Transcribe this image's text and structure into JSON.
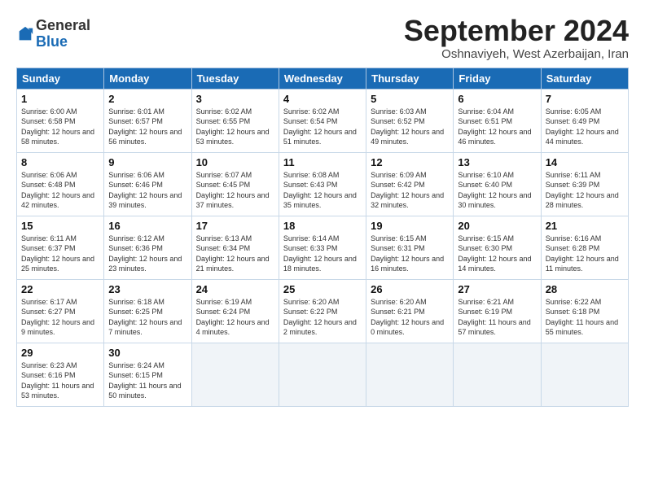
{
  "header": {
    "logo_general": "General",
    "logo_blue": "Blue",
    "month_title": "September 2024",
    "subtitle": "Oshnaviyeh, West Azerbaijan, Iran"
  },
  "weekdays": [
    "Sunday",
    "Monday",
    "Tuesday",
    "Wednesday",
    "Thursday",
    "Friday",
    "Saturday"
  ],
  "weeks": [
    [
      {
        "day": "1",
        "sunrise": "6:00 AM",
        "sunset": "6:58 PM",
        "daylight": "12 hours and 58 minutes."
      },
      {
        "day": "2",
        "sunrise": "6:01 AM",
        "sunset": "6:57 PM",
        "daylight": "12 hours and 56 minutes."
      },
      {
        "day": "3",
        "sunrise": "6:02 AM",
        "sunset": "6:55 PM",
        "daylight": "12 hours and 53 minutes."
      },
      {
        "day": "4",
        "sunrise": "6:02 AM",
        "sunset": "6:54 PM",
        "daylight": "12 hours and 51 minutes."
      },
      {
        "day": "5",
        "sunrise": "6:03 AM",
        "sunset": "6:52 PM",
        "daylight": "12 hours and 49 minutes."
      },
      {
        "day": "6",
        "sunrise": "6:04 AM",
        "sunset": "6:51 PM",
        "daylight": "12 hours and 46 minutes."
      },
      {
        "day": "7",
        "sunrise": "6:05 AM",
        "sunset": "6:49 PM",
        "daylight": "12 hours and 44 minutes."
      }
    ],
    [
      {
        "day": "8",
        "sunrise": "6:06 AM",
        "sunset": "6:48 PM",
        "daylight": "12 hours and 42 minutes."
      },
      {
        "day": "9",
        "sunrise": "6:06 AM",
        "sunset": "6:46 PM",
        "daylight": "12 hours and 39 minutes."
      },
      {
        "day": "10",
        "sunrise": "6:07 AM",
        "sunset": "6:45 PM",
        "daylight": "12 hours and 37 minutes."
      },
      {
        "day": "11",
        "sunrise": "6:08 AM",
        "sunset": "6:43 PM",
        "daylight": "12 hours and 35 minutes."
      },
      {
        "day": "12",
        "sunrise": "6:09 AM",
        "sunset": "6:42 PM",
        "daylight": "12 hours and 32 minutes."
      },
      {
        "day": "13",
        "sunrise": "6:10 AM",
        "sunset": "6:40 PM",
        "daylight": "12 hours and 30 minutes."
      },
      {
        "day": "14",
        "sunrise": "6:11 AM",
        "sunset": "6:39 PM",
        "daylight": "12 hours and 28 minutes."
      }
    ],
    [
      {
        "day": "15",
        "sunrise": "6:11 AM",
        "sunset": "6:37 PM",
        "daylight": "12 hours and 25 minutes."
      },
      {
        "day": "16",
        "sunrise": "6:12 AM",
        "sunset": "6:36 PM",
        "daylight": "12 hours and 23 minutes."
      },
      {
        "day": "17",
        "sunrise": "6:13 AM",
        "sunset": "6:34 PM",
        "daylight": "12 hours and 21 minutes."
      },
      {
        "day": "18",
        "sunrise": "6:14 AM",
        "sunset": "6:33 PM",
        "daylight": "12 hours and 18 minutes."
      },
      {
        "day": "19",
        "sunrise": "6:15 AM",
        "sunset": "6:31 PM",
        "daylight": "12 hours and 16 minutes."
      },
      {
        "day": "20",
        "sunrise": "6:15 AM",
        "sunset": "6:30 PM",
        "daylight": "12 hours and 14 minutes."
      },
      {
        "day": "21",
        "sunrise": "6:16 AM",
        "sunset": "6:28 PM",
        "daylight": "12 hours and 11 minutes."
      }
    ],
    [
      {
        "day": "22",
        "sunrise": "6:17 AM",
        "sunset": "6:27 PM",
        "daylight": "12 hours and 9 minutes."
      },
      {
        "day": "23",
        "sunrise": "6:18 AM",
        "sunset": "6:25 PM",
        "daylight": "12 hours and 7 minutes."
      },
      {
        "day": "24",
        "sunrise": "6:19 AM",
        "sunset": "6:24 PM",
        "daylight": "12 hours and 4 minutes."
      },
      {
        "day": "25",
        "sunrise": "6:20 AM",
        "sunset": "6:22 PM",
        "daylight": "12 hours and 2 minutes."
      },
      {
        "day": "26",
        "sunrise": "6:20 AM",
        "sunset": "6:21 PM",
        "daylight": "12 hours and 0 minutes."
      },
      {
        "day": "27",
        "sunrise": "6:21 AM",
        "sunset": "6:19 PM",
        "daylight": "11 hours and 57 minutes."
      },
      {
        "day": "28",
        "sunrise": "6:22 AM",
        "sunset": "6:18 PM",
        "daylight": "11 hours and 55 minutes."
      }
    ],
    [
      {
        "day": "29",
        "sunrise": "6:23 AM",
        "sunset": "6:16 PM",
        "daylight": "11 hours and 53 minutes."
      },
      {
        "day": "30",
        "sunrise": "6:24 AM",
        "sunset": "6:15 PM",
        "daylight": "11 hours and 50 minutes."
      },
      null,
      null,
      null,
      null,
      null
    ]
  ]
}
